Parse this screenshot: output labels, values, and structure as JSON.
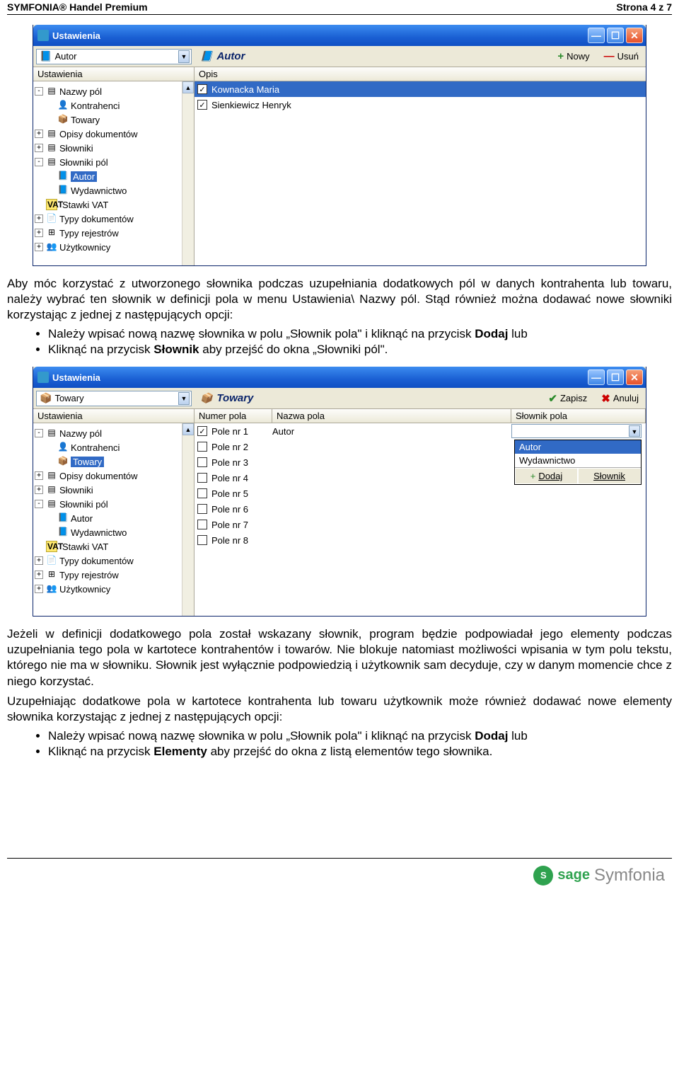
{
  "header": {
    "product": "SYMFONIA® Handel Premium",
    "page": "Strona 4 z 7"
  },
  "win1": {
    "title": "Ustawienia",
    "selector": "Autor",
    "midlabel": "Autor",
    "btn_new": "Nowy",
    "btn_del": "Usuń",
    "left_hdr": "Ustawienia",
    "right_hdr": "Opis",
    "tree": {
      "i0": "Nazwy pól",
      "i1": "Kontrahenci",
      "i2": "Towary",
      "i3": "Opisy dokumentów",
      "i4": "Słowniki",
      "i5": "Słowniki pól",
      "i6": "Autor",
      "i7": "Wydawnictwo",
      "i8": "Stawki VAT",
      "i9": "Typy dokumentów",
      "i10": "Typy rejestrów",
      "i11": "Użytkownicy"
    },
    "rows": {
      "r0": "Kownacka Maria",
      "r1": "Sienkiewicz Henryk"
    }
  },
  "para1": "Aby móc korzystać z utworzonego słownika podczas uzupełniania dodatkowych pól w danych kontrahenta lub towaru, należy wybrać ten słownik w definicji pola w menu Ustawienia\\ Nazwy pól. Stąd również można dodawać nowe słowniki korzystając z jednej z następujących opcji:",
  "bul1": {
    "a_pre": "Należy wpisać nową nazwę słownika w polu „Słownik pola\" i kliknąć na przycisk ",
    "a_b": "Dodaj",
    "a_post": " lub",
    "b_pre": "Kliknąć na przycisk ",
    "b_b": "Słownik",
    "b_post": " aby przejść do okna „Słowniki pól\"."
  },
  "win2": {
    "title": "Ustawienia",
    "selector": "Towary",
    "midlabel": "Towary",
    "btn_save": "Zapisz",
    "btn_cancel": "Anuluj",
    "left_hdr": "Ustawienia",
    "hdr_num": "Numer pola",
    "hdr_name": "Nazwa pola",
    "hdr_dict": "Słownik pola",
    "tree": {
      "i0": "Nazwy pól",
      "i1": "Kontrahenci",
      "i2": "Towary",
      "i3": "Opisy dokumentów",
      "i4": "Słowniki",
      "i5": "Słowniki pól",
      "i6": "Autor",
      "i7": "Wydawnictwo",
      "i8": "Stawki VAT",
      "i9": "Typy dokumentów",
      "i10": "Typy rejestrów",
      "i11": "Użytkownicy"
    },
    "rows": {
      "r0n": "Pole nr 1",
      "r0v": "Autor",
      "r1n": "Pole nr 2",
      "r2n": "Pole nr 3",
      "r3n": "Pole nr 4",
      "r4n": "Pole nr 5",
      "r5n": "Pole nr 6",
      "r6n": "Pole nr 7",
      "r7n": "Pole nr 8"
    },
    "dd": {
      "o0": "Autor",
      "o1": "Wydawnictwo",
      "add": "Dodaj",
      "dict": "Słownik"
    }
  },
  "para2": "Jeżeli w definicji dodatkowego pola został wskazany słownik, program będzie podpowiadał jego elementy podczas uzupełniania tego pola w kartotece kontrahentów i towarów. Nie blokuje natomiast możliwości wpisania w tym polu tekstu, którego nie ma w słowniku. Słownik jest wyłącznie podpowiedzią i użytkownik sam decyduje, czy w danym momencie chce z niego korzystać.",
  "para3": "Uzupełniając dodatkowe pola w kartotece kontrahenta lub towaru użytkownik może również dodawać nowe elementy słownika korzystając z jednej z następujących opcji:",
  "bul2": {
    "a_pre": "Należy wpisać nową nazwę słownika w polu „Słownik pola\" i kliknąć na przycisk ",
    "a_b": "Dodaj",
    "a_post": " lub",
    "b_pre": "Kliknąć na przycisk ",
    "b_b": "Elementy",
    "b_post": " aby przejść do okna z listą elementów tego słownika."
  },
  "footer": {
    "brand1": "sage",
    "brand2": "Symfonia"
  }
}
